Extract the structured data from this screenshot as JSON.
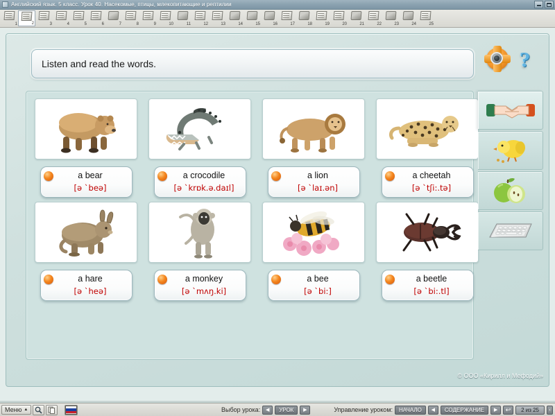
{
  "window": {
    "title": "Английский язык. 5 класс. Урок 40. Насекомые, птицы, млекопитающие и рептилии",
    "minimize_label": "—",
    "restore_label": "❐"
  },
  "slidebar": {
    "selected_index": 2,
    "slides": [
      {
        "num": "1",
        "type": "slide"
      },
      {
        "num": "2",
        "type": "slide"
      },
      {
        "num": "3",
        "type": "slide"
      },
      {
        "num": "4",
        "type": "slide"
      },
      {
        "num": "5",
        "type": "slide"
      },
      {
        "num": "6",
        "type": "slide"
      },
      {
        "num": "7",
        "type": "audio"
      },
      {
        "num": "8",
        "type": "slide"
      },
      {
        "num": "9",
        "type": "slide"
      },
      {
        "num": "10",
        "type": "slide"
      },
      {
        "num": "11",
        "type": "audio"
      },
      {
        "num": "12",
        "type": "slide"
      },
      {
        "num": "13",
        "type": "slide"
      },
      {
        "num": "14",
        "type": "audio"
      },
      {
        "num": "15",
        "type": "audio"
      },
      {
        "num": "16",
        "type": "audio"
      },
      {
        "num": "17",
        "type": "slide"
      },
      {
        "num": "18",
        "type": "audio"
      },
      {
        "num": "19",
        "type": "slide"
      },
      {
        "num": "20",
        "type": "slide"
      },
      {
        "num": "21",
        "type": "audio"
      },
      {
        "num": "22",
        "type": "slide"
      },
      {
        "num": "23",
        "type": "audio"
      },
      {
        "num": "24",
        "type": "audio"
      },
      {
        "num": "25",
        "type": "slide"
      }
    ]
  },
  "lesson": {
    "prompt": "Listen and read the words.",
    "copyright": "© ООО «Кирилл и Мефодий»",
    "tools": [
      {
        "name": "speaker-icon",
        "title": "Озвучить"
      },
      {
        "name": "help-icon",
        "title": "Справка"
      }
    ],
    "cards": [
      {
        "label": "a bear",
        "ipa": "[ə `beə]",
        "image": "bear"
      },
      {
        "label": "a crocodile",
        "ipa": "[ə `krɒk.ə.daɪl]",
        "image": "crocodile"
      },
      {
        "label": "a lion",
        "ipa": "[ə `laɪ.ən]",
        "image": "lion"
      },
      {
        "label": "a cheetah",
        "ipa": "[ə `tʃi:.tə]",
        "image": "cheetah"
      },
      {
        "label": "a hare",
        "ipa": "[ə `heə]",
        "image": "hare"
      },
      {
        "label": "a monkey",
        "ipa": "[ə `mʌŋ.ki]",
        "image": "monkey"
      },
      {
        "label": "a bee",
        "ipa": "[ə `bi:]",
        "image": "bee"
      },
      {
        "label": "a beetle",
        "ipa": "[ə `bi:.tl]",
        "image": "beetle"
      }
    ],
    "rail_tabs": [
      {
        "name": "handshake-icon",
        "active": true
      },
      {
        "name": "chick-icon",
        "active": false
      },
      {
        "name": "apples-icon",
        "active": false
      },
      {
        "name": "keyboard-icon",
        "active": false
      }
    ]
  },
  "statusbar": {
    "menu_label": "Меню",
    "menu_caret": "▲",
    "search_icon": "search-icon",
    "copy_icon": "copy-icon",
    "language_icon": "russian-flag-icon",
    "lesson_select_label": "Выбор урока:",
    "lesson_prev": "◀",
    "lesson_value": "УРОК",
    "lesson_next": "▶",
    "lesson_control_label": "Управление уроком:",
    "start_label": "НАЧАЛО",
    "prev_label": "◀",
    "contents_label": "СОДЕРЖАНИЕ",
    "next_label": "▶",
    "back_icon": "back-arrow-icon",
    "page_counter": "2 из 25",
    "more_label": "‹"
  },
  "colors": {
    "accent_orange": "#f4871f",
    "ipa_red": "#c00000",
    "panel_teal": "#cfe2e0",
    "titlebar_blue": "#8ba2b0"
  }
}
